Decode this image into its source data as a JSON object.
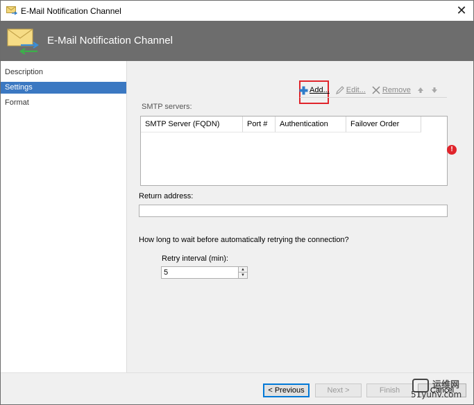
{
  "window": {
    "title": "E-Mail Notification Channel",
    "close_glyph": "✕"
  },
  "banner": {
    "title": "E-Mail Notification Channel",
    "icon": "envelope-arrows-icon"
  },
  "nav": {
    "items": [
      {
        "label": "Description",
        "active": false
      },
      {
        "label": "Settings",
        "active": true
      },
      {
        "label": "Format",
        "active": false
      }
    ]
  },
  "toolbar": {
    "add_label": "Add...",
    "edit_label": "Edit...",
    "remove_label": "Remove",
    "move_up_icon": "arrow-up-icon",
    "move_down_icon": "arrow-down-icon"
  },
  "smtp": {
    "label": "SMTP servers:",
    "columns": [
      "SMTP Server (FQDN)",
      "Port #",
      "Authentication",
      "Failover Order"
    ],
    "rows": []
  },
  "return_address": {
    "label": "Return address:",
    "value": ""
  },
  "retry": {
    "question": "How long to wait before automatically retrying the connection?",
    "label": "Retry interval (min):",
    "value": "5"
  },
  "footer": {
    "previous_label": "< Previous",
    "next_label": "Next >",
    "finish_label": "Finish",
    "cancel_label": "Cancel"
  },
  "watermark": {
    "top_text": "运维网",
    "bottom_text": "51yunv.com"
  },
  "colors": {
    "banner": "#6d6d6d",
    "nav_active": "#3b78c2",
    "highlight": "#e0242b",
    "error": "#e0242b"
  }
}
